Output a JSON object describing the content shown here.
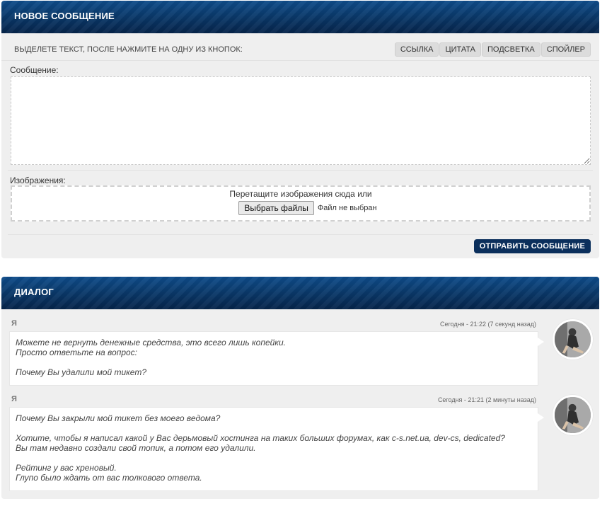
{
  "new_message": {
    "title": "НОВОЕ СООБЩЕНИЕ",
    "toolbar_hint": "ВЫДЕЛЕТЕ ТЕКСТ, ПОСЛЕ НАЖМИТЕ НА ОДНУ ИЗ КНОПОК:",
    "buttons": [
      "ССЫЛКА",
      "ЦИТАТА",
      "ПОДСВЕТКА",
      "СПОЙЛЕР"
    ],
    "message_label": "Сообщение:",
    "message_value": "",
    "images_label": "Изображения:",
    "drop_text": "Перетащите изображения сюда или",
    "file_button": "Выбрать файлы",
    "file_status": "Файл не выбран",
    "send_button": "ОТПРАВИТЬ СООБЩЕНИЕ"
  },
  "dialog": {
    "title": "ДИАЛОГ",
    "messages": [
      {
        "author": "Я",
        "time": "Сегодня - 21:22 (7 секунд назад)",
        "text": "Можете не вернуть денежные средства, это всего лишь копейки.\nПросто ответьте на вопрос:\n\nПочему Вы удалили мой тикет?"
      },
      {
        "author": "Я",
        "time": "Сегодня - 21:21 (2 минуты назад)",
        "text": "Почему Вы закрыли мой тикет без моего ведома?\n\nХотите, чтобы я написал какой у Вас дерьмовый хостинга на таких больших форумах, как c-s.net.ua, dev-cs, dedicated?\nВы там недавно создали свой топик, а потом его удалили.\n\nРейтинг у вас хреновый.\nГлупо было ждать от вас толкового ответа."
      }
    ]
  }
}
